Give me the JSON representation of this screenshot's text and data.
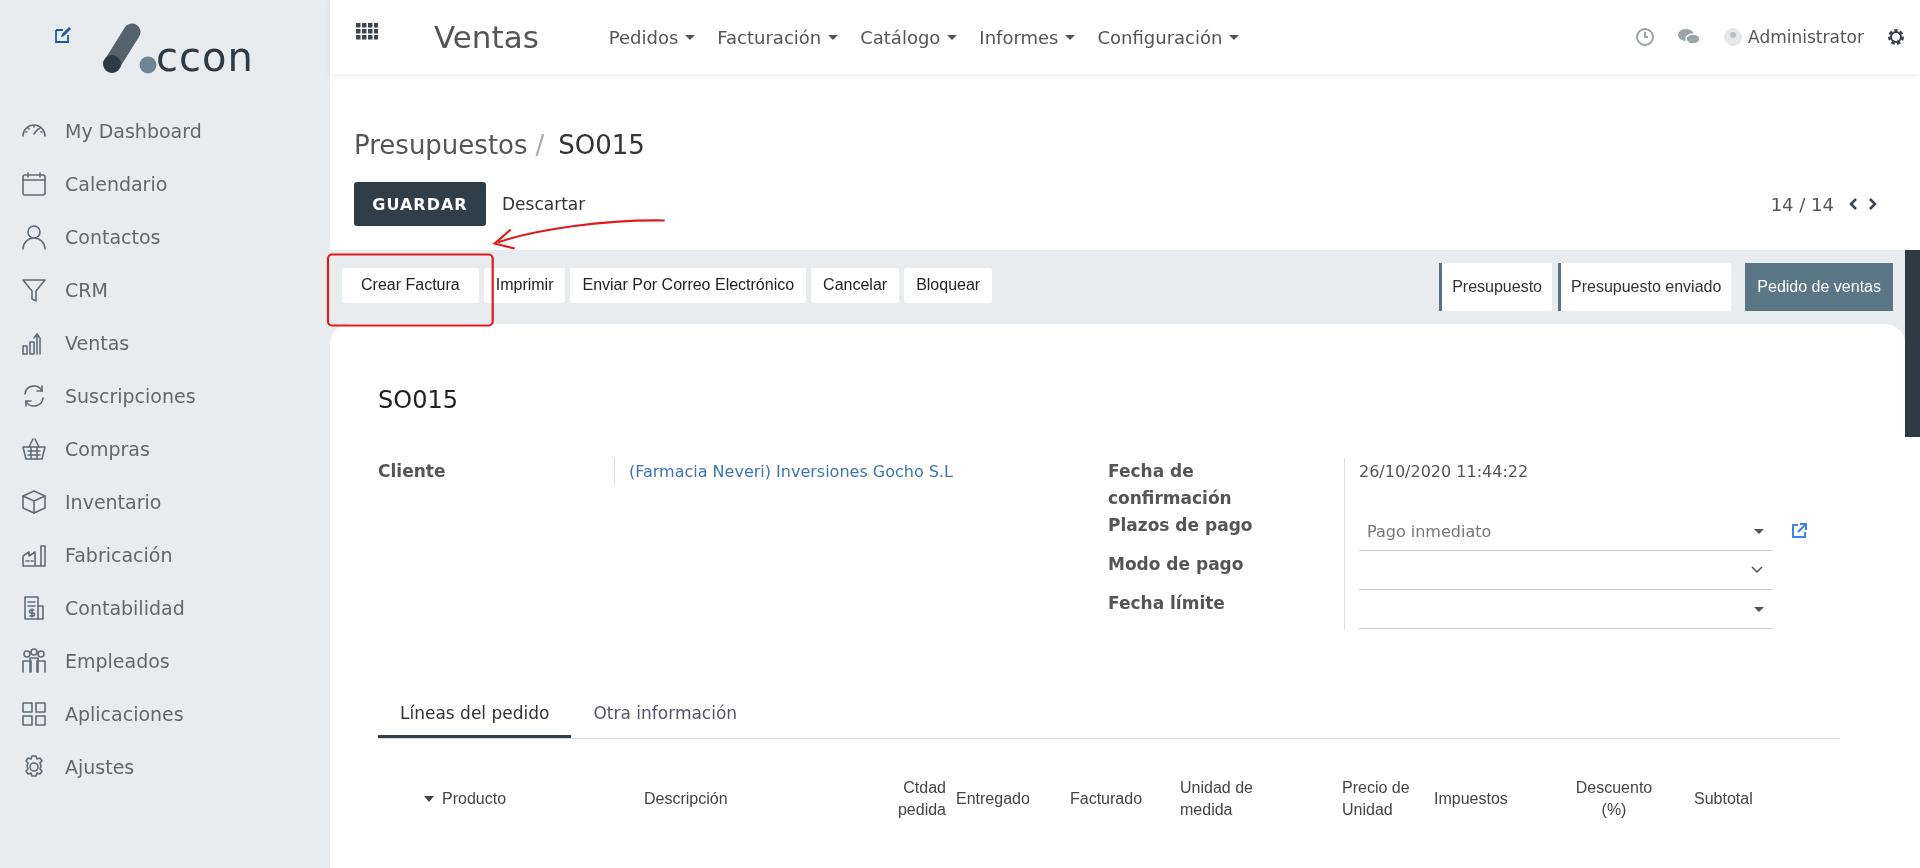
{
  "sidebar": {
    "items": [
      {
        "label": "My Dashboard"
      },
      {
        "label": "Calendario"
      },
      {
        "label": "Contactos"
      },
      {
        "label": "CRM"
      },
      {
        "label": "Ventas"
      },
      {
        "label": "Suscripciones"
      },
      {
        "label": "Compras"
      },
      {
        "label": "Inventario"
      },
      {
        "label": "Fabricación"
      },
      {
        "label": "Contabilidad"
      },
      {
        "label": "Empleados"
      },
      {
        "label": "Aplicaciones"
      },
      {
        "label": "Ajustes"
      }
    ],
    "logo_text": "ccon"
  },
  "topbar": {
    "app_title": "Ventas",
    "menus": [
      "Pedidos",
      "Facturación",
      "Catálogo",
      "Informes",
      "Configuración"
    ],
    "user": "Administrator"
  },
  "breadcrumb": {
    "items": [
      "Presupuestos",
      "SO015"
    ],
    "separator": "/"
  },
  "save_button": "GUARDAR",
  "discard_button": "Descartar",
  "pager": "14 / 14",
  "actions": [
    {
      "label": "Crear Factura",
      "highlighted": true
    },
    {
      "label": "Imprimir",
      "highlighted": false
    },
    {
      "label": "Enviar Por Correo Electrónico",
      "highlighted": false
    },
    {
      "label": "Cancelar",
      "highlighted": false
    },
    {
      "label": "Bloquear",
      "highlighted": false
    }
  ],
  "stages": [
    {
      "label": "Presupuesto",
      "selected": false
    },
    {
      "label": "Presupuesto enviado",
      "selected": false
    },
    {
      "label": "Pedido de ventas",
      "selected": true
    }
  ],
  "form": {
    "title": "SO015",
    "left_fields": [
      {
        "label": "Cliente",
        "value": "(Farmacia Neveri) Inversiones Gocho S.L",
        "kind": "link"
      }
    ],
    "right_fields": [
      {
        "label": "Fecha de confirmación",
        "value": "26/10/2020 11:44:22",
        "kind": "text"
      },
      {
        "label": "Plazos de pago",
        "value": "Pago inmediato",
        "kind": "select"
      },
      {
        "label": "Modo de pago",
        "kind": "chevron-select"
      },
      {
        "label": "Fecha límite",
        "kind": "select"
      }
    ],
    "tabs": [
      {
        "label": "Líneas del pedido",
        "selected": true
      },
      {
        "label": "Otra información",
        "selected": false
      }
    ],
    "columns": [
      {
        "label": "Producto",
        "sorted": true
      },
      {
        "label": "Descripción",
        "sorted": false
      },
      {
        "label": "Ctdad pedida",
        "sorted": false
      },
      {
        "label": "Entregado",
        "sorted": false
      },
      {
        "label": "Facturado",
        "sorted": false
      },
      {
        "label": "Unidad de medida",
        "sorted": false
      },
      {
        "label": "Precio de Unidad",
        "sorted": false
      },
      {
        "label": "Impuestos",
        "sorted": false
      },
      {
        "label": "Descuento (%)",
        "sorted": false
      },
      {
        "label": "Subtotal",
        "sorted": false
      }
    ]
  }
}
